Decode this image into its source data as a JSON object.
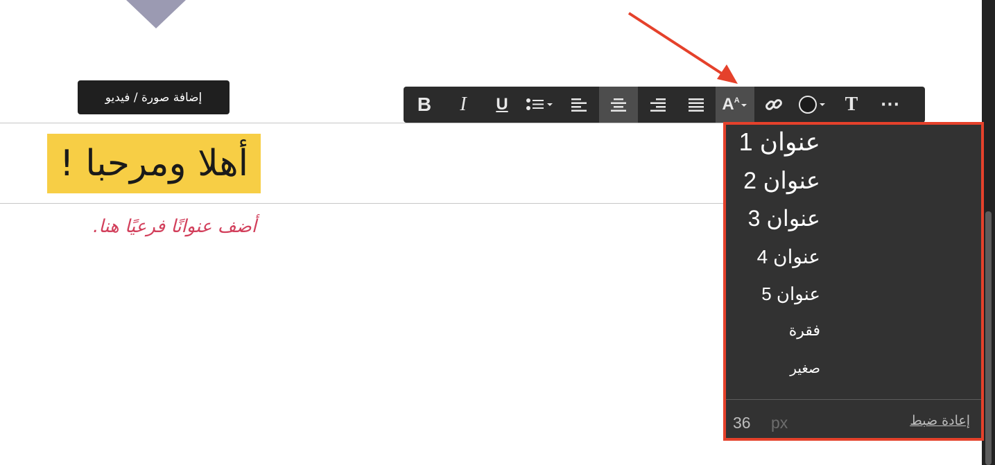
{
  "colors": {
    "title_highlight": "#f7ce45",
    "subtitle_color": "#d23f5b",
    "annotation_color": "#e5412b",
    "toolbar_bg": "#2b2b2b",
    "dropdown_bg": "#323232"
  },
  "canvas": {
    "media_button_label": "إضافة صورة / فيديو",
    "title": "أهلا ومرحبا !",
    "subtitle": "أضف عنوانًا فرعيًا هنا."
  },
  "toolbar": {
    "buttons": [
      {
        "name": "bold",
        "icon": "bold-icon",
        "glyph": "B"
      },
      {
        "name": "italic",
        "icon": "italic-icon",
        "glyph": "I"
      },
      {
        "name": "underline",
        "icon": "underline-icon",
        "glyph": "U"
      },
      {
        "name": "list",
        "icon": "bullet-list-dropdown-icon"
      },
      {
        "name": "align-left",
        "icon": "align-left-icon"
      },
      {
        "name": "align-center",
        "icon": "align-center-icon",
        "active": true
      },
      {
        "name": "align-right",
        "icon": "align-right-icon"
      },
      {
        "name": "justify",
        "icon": "align-justify-icon"
      },
      {
        "name": "font-size",
        "icon": "font-size-dropdown-icon",
        "glyph": "A"
      },
      {
        "name": "link",
        "icon": "link-icon"
      },
      {
        "name": "text-color",
        "icon": "color-circle-dropdown-icon"
      },
      {
        "name": "clear-format",
        "icon": "text-format-icon",
        "glyph": "T"
      },
      {
        "name": "more",
        "icon": "more-horizontal-icon",
        "glyph": "···"
      }
    ]
  },
  "dropdown": {
    "items": [
      "عنوان 1",
      "عنوان 2",
      "عنوان 3",
      "عنوان 4",
      "عنوان 5",
      "فقرة",
      "صغير"
    ],
    "size_value": "36",
    "size_unit": "px",
    "reset_label": "إعادة ضبط"
  }
}
